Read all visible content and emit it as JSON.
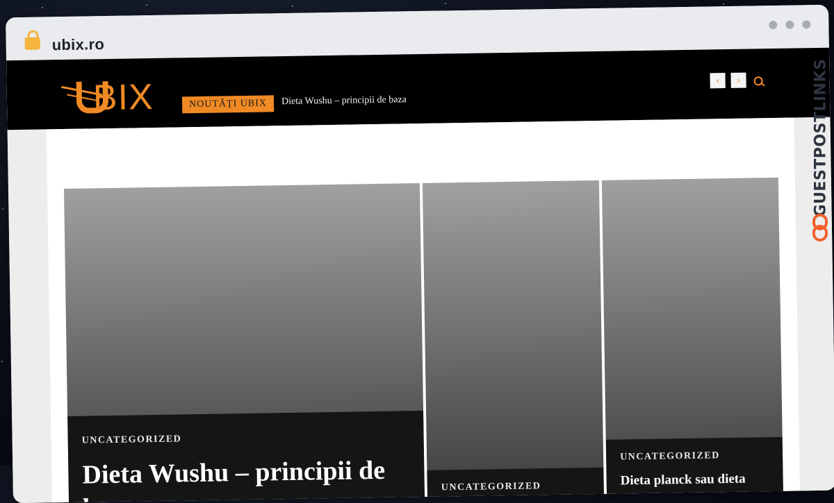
{
  "browser": {
    "url": "ubix.ro"
  },
  "header": {
    "logo_text": "BIX",
    "badge_label": "NOUTĂȚI UBIX",
    "ticker_text": "Dieta Wushu – principii de baza",
    "prev_label": "‹",
    "next_label": "›"
  },
  "posts": [
    {
      "category": "UNCATEGORIZED",
      "title": "Dieta Wushu – principii de baza"
    },
    {
      "category": "UNCATEGORIZED",
      "title": ""
    },
    {
      "category": "UNCATEGORIZED",
      "title": "Dieta planck sau dieta"
    }
  ],
  "watermark": {
    "text": "GUESTPOSTLINKS"
  },
  "colors": {
    "accent": "#f08a24",
    "header_bg": "#000000",
    "card_meta_bg": "#151515"
  }
}
